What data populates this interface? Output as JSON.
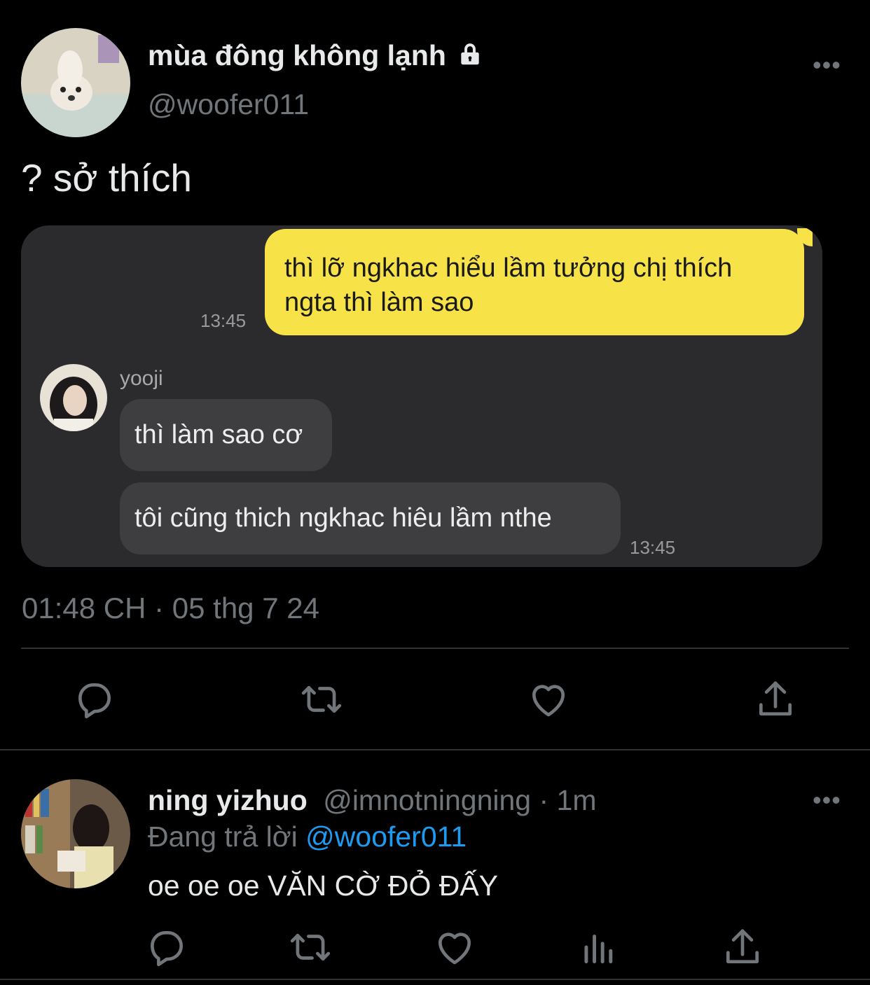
{
  "main_tweet": {
    "display_name": "mùa đông không lạnh",
    "protected_icon": "lock-icon",
    "handle": "@woofer011",
    "more_icon": "more-dots-icon",
    "more_label": "•••",
    "text": "? sở thích",
    "embedded_chat": {
      "outgoing": {
        "text": "thì lỡ ngkhac hiểu lầm tưởng chị thích ngta thì làm sao",
        "time": "13:45"
      },
      "incoming": {
        "sender": "yooji",
        "messages": [
          {
            "text": "thì làm sao cơ"
          },
          {
            "text": "tôi cũng thich ngkhac hiêu lầm nthe"
          }
        ],
        "time": "13:45"
      }
    },
    "timestamp": "01:48 CH · 05 thg 7 24",
    "actions": [
      "reply-icon",
      "retweet-icon",
      "like-icon",
      "share-icon"
    ]
  },
  "reply_tweet": {
    "display_name": "ning yizhuo",
    "handle_time": "@imnotningning · 1m",
    "more_label": "•••",
    "replying_prefix": "Đang trả lời",
    "replying_to": "@woofer011",
    "text": "oe oe oe VĂN CỜ ĐỎ ĐẤY",
    "actions": [
      "reply-icon",
      "retweet-icon",
      "like-icon",
      "views-icon",
      "share-icon"
    ]
  },
  "colors": {
    "background": "#000000",
    "text_primary": "#e7e9ea",
    "text_secondary": "#71767b",
    "link": "#1d9bf0",
    "chat_card": "#2b2b2d",
    "outgoing_bubble": "#f7e247",
    "incoming_bubble": "#3e3e40"
  }
}
